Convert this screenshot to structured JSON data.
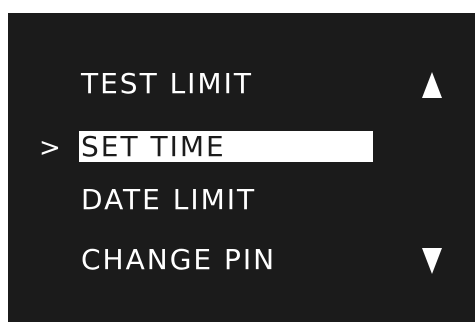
{
  "menu": {
    "cursor": ">",
    "items": [
      {
        "label": "TEST LIMIT"
      },
      {
        "label": "SET TIME"
      },
      {
        "label": "DATE LIMIT"
      },
      {
        "label": "CHANGE PIN"
      }
    ],
    "selected_index": 1
  },
  "colors": {
    "screen_bg": "#1b1b1b",
    "text": "#ffffff",
    "highlight_bg": "#ffffff",
    "highlight_text": "#1b1b1b"
  },
  "icons": {
    "scroll_up": "triangle-up-icon",
    "scroll_down": "triangle-down-icon"
  }
}
